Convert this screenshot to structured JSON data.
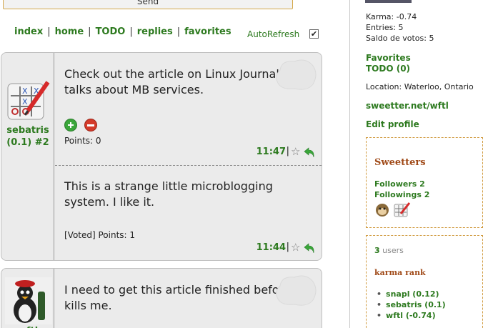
{
  "composer": {
    "send_label": "Send"
  },
  "nav": {
    "items": [
      {
        "label": "index"
      },
      {
        "label": "home"
      },
      {
        "label": "TODO"
      },
      {
        "label": "replies"
      },
      {
        "label": "favorites"
      }
    ],
    "autorefresh_label": "AutoRefresh",
    "autorefresh_checked": "✔"
  },
  "threads": [
    {
      "user": {
        "name": "sebatris",
        "meta": "(0.1) #2"
      },
      "posts": [
        {
          "text": "Check out the article on Linux Journal that talks about MB services.",
          "points": "Points: 0",
          "time": "11:47",
          "pipe": "|"
        },
        {
          "text": "This is a strange little microblogging system. I like it.",
          "points": "[Voted] Points: 1",
          "time": "11:44",
          "pipe": "|"
        }
      ]
    },
    {
      "user": {
        "name": "wftl"
      },
      "posts": [
        {
          "text": "I need to get this article finished before Jill kills me."
        }
      ]
    }
  ],
  "sidebar": {
    "karma": "Karma: -0.74",
    "entries": "Entries: 5",
    "saldo": "Saldo de votos: 5",
    "favorites_link": "Favorites",
    "todo_link": "TODO (0)",
    "location": "Location: Waterloo, Ontario",
    "profile_url": "sweetter.net/wftl",
    "edit_profile": "Edit profile",
    "sweetters": {
      "title": "Sweetters",
      "followers": "Followers 2",
      "followings": "Followings 2"
    },
    "users_panel": {
      "count": "3",
      "users_word": "users",
      "rank_title": "karma rank",
      "ranks": [
        "snapl (0.12)",
        "sebatris (0.1)",
        "wftl (-0.74)"
      ]
    }
  },
  "colors": {
    "accent": "#2d7a1f",
    "card_bg": "#ebebeb",
    "panel_border": "#d09a3e",
    "title": "#a04a18"
  }
}
